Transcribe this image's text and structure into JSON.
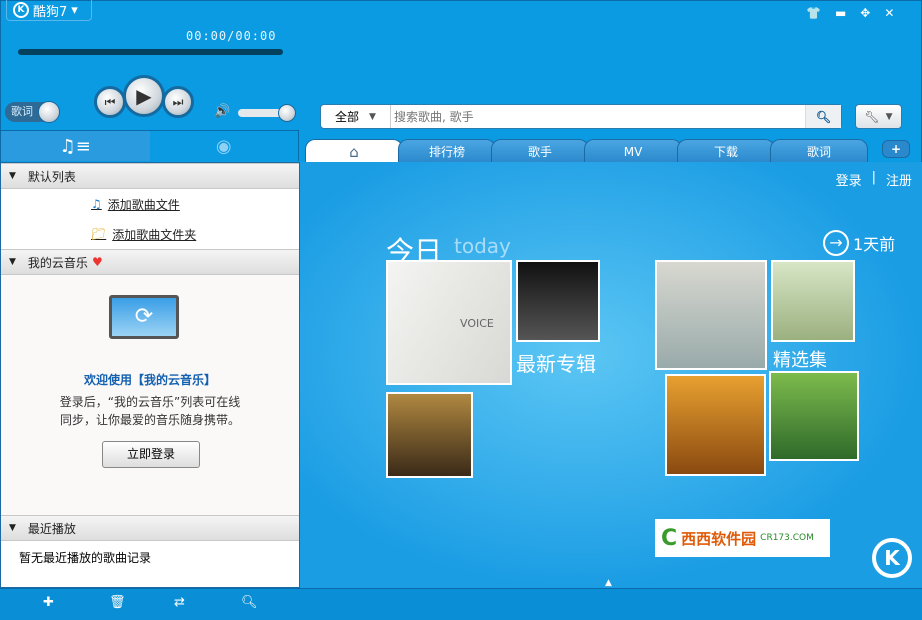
{
  "app": {
    "title": "酷狗7",
    "logo": "K"
  },
  "player": {
    "time": "00:00/00:00",
    "lyrics_toggle": "歌词",
    "progress": 0,
    "volume": 0.9
  },
  "search": {
    "scope": "全部",
    "placeholder": "搜索歌曲, 歌手"
  },
  "tabs": [
    "排行榜",
    "歌手",
    "MV",
    "下载",
    "歌词"
  ],
  "sidebar": {
    "default_list": "默认列表",
    "add_file": "添加歌曲文件",
    "add_folder": "添加歌曲文件夹",
    "cloud": "我的云音乐",
    "welcome": "欢迎使用【我的云音乐】",
    "desc1": "登录后，“我的云音乐”列表可在线",
    "desc2": "同步，让你最爱的音乐随身携带。",
    "login_btn": "立即登录",
    "recent": "最近播放",
    "recent_empty": "暂无最近播放的歌曲记录"
  },
  "main": {
    "login": "登录",
    "sep": "|",
    "register": "注册",
    "today": "今日",
    "today_en": "today",
    "prev_day": "1天前",
    "albums": "最新专辑",
    "collections": "精选集",
    "album_text": "VOICE",
    "watermark": "西西软件园",
    "watermark_url": "CR173.COM"
  }
}
